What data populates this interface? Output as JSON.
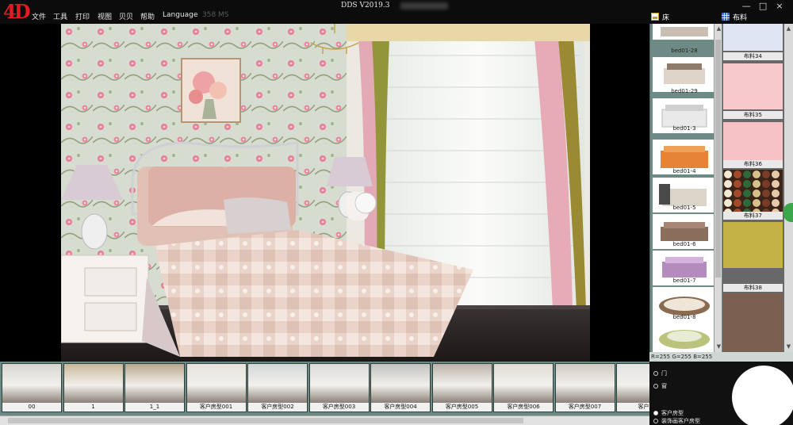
{
  "app": {
    "logo": "4D",
    "title": "DDS V2019.3",
    "menu": [
      "文件",
      "工具",
      "打印",
      "视图",
      "贝贝",
      "帮助",
      "Language",
      "358 MS"
    ]
  },
  "window_controls": [
    "—",
    "□",
    "×"
  ],
  "panels": {
    "model_header": "床",
    "fabric_header": "布料"
  },
  "models": [
    {
      "label": "bed01-28"
    },
    {
      "label": "bed01-29"
    },
    {
      "label": "bed01-3"
    },
    {
      "label": "bed01-4"
    },
    {
      "label": "bed01-5"
    },
    {
      "label": "bed01-6"
    },
    {
      "label": "bed01-7"
    },
    {
      "label": "bed01-8"
    },
    {
      "label": ""
    }
  ],
  "fabrics": [
    {
      "label": "布料34",
      "color": "#dfe6f2"
    },
    {
      "label": "布料35",
      "color": "#f7c9cd"
    },
    {
      "label": "布料36",
      "color": "#f6c2c6"
    },
    {
      "label": "布料37",
      "color": "#3a2418"
    },
    {
      "label": "布料38",
      "color": "#c3b244"
    },
    {
      "label": "",
      "color": "#7b6050"
    }
  ],
  "status_text": "R=255 G=255 B=255",
  "rooms": [
    {
      "label": "00"
    },
    {
      "label": "1"
    },
    {
      "label": "1_1"
    },
    {
      "label": "客户房型001"
    },
    {
      "label": "客户房型002"
    },
    {
      "label": "客户房型003"
    },
    {
      "label": "客户房型004"
    },
    {
      "label": "客户房型005"
    },
    {
      "label": "客户房型006"
    },
    {
      "label": "客户房型007"
    },
    {
      "label": "客户房"
    }
  ],
  "options": [
    {
      "label": "门",
      "selected": false
    },
    {
      "label": "窗",
      "selected": false
    },
    {
      "label": "客户房型",
      "selected": true
    },
    {
      "label": "装饰画客户房型",
      "selected": false
    }
  ],
  "colors": {
    "accent": "#e31b23",
    "panel": "#6e8a85",
    "fabric_panel": "#686868"
  }
}
